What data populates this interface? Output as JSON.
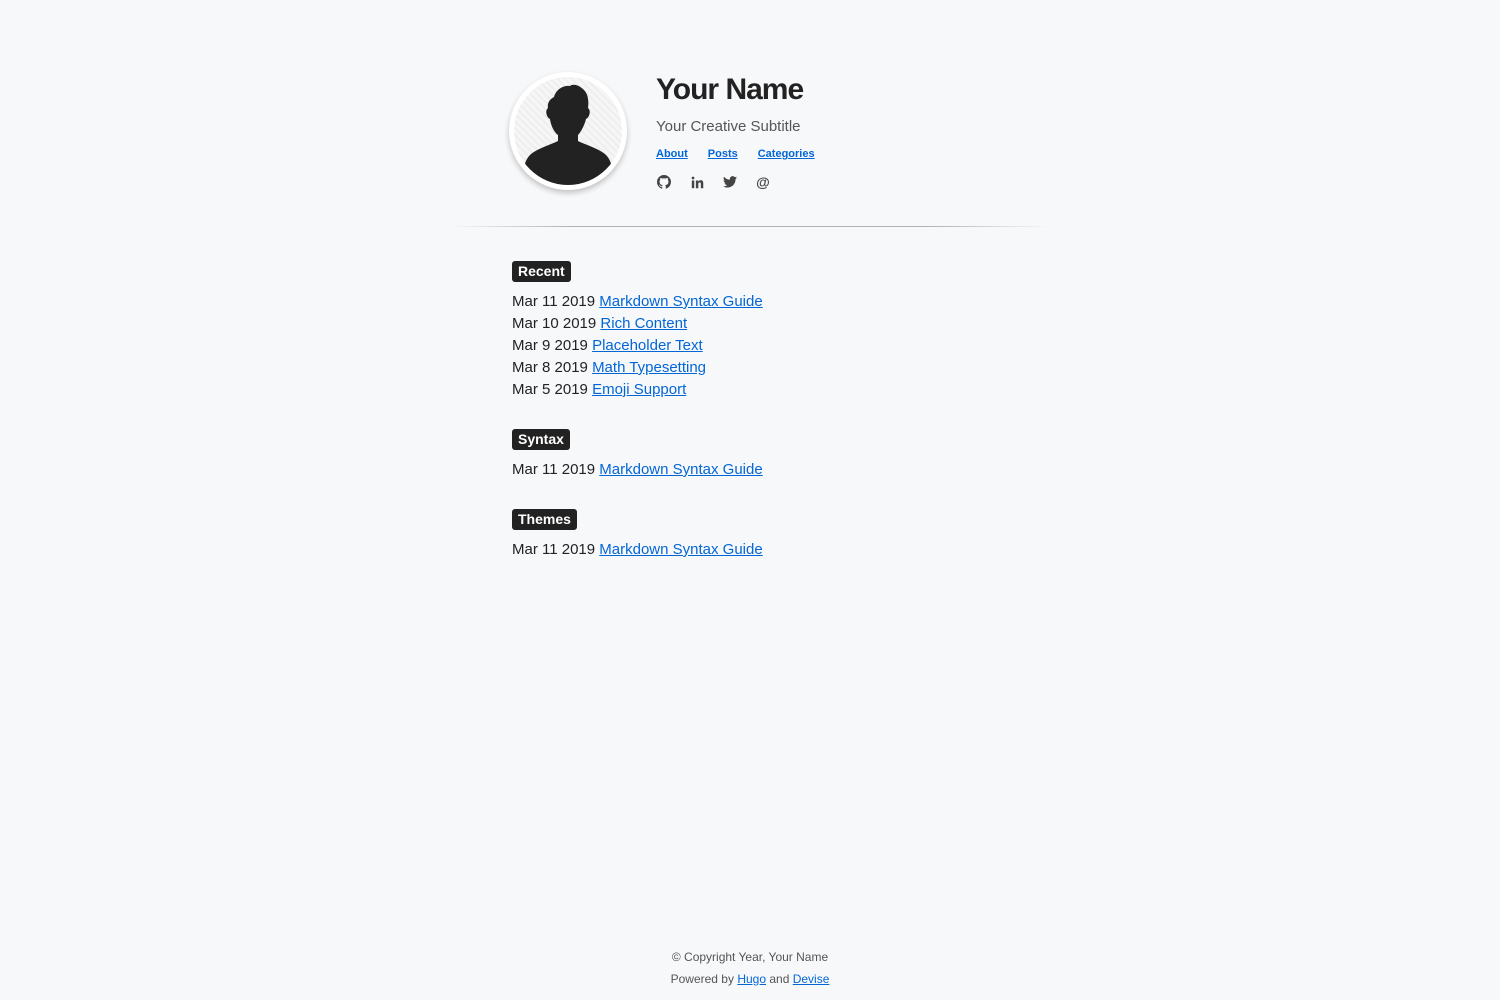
{
  "header": {
    "title": "Your Name",
    "subtitle": "Your Creative Subtitle",
    "nav": [
      {
        "label": "About"
      },
      {
        "label": "Posts"
      },
      {
        "label": "Categories"
      }
    ],
    "social": [
      {
        "icon": "github-icon"
      },
      {
        "icon": "linkedin-icon"
      },
      {
        "icon": "twitter-icon"
      },
      {
        "icon": "email-at-icon",
        "glyph": "@"
      }
    ]
  },
  "sections": [
    {
      "label": "Recent",
      "posts": [
        {
          "date": "Mar 11 2019",
          "title": "Markdown Syntax Guide"
        },
        {
          "date": "Mar 10 2019",
          "title": "Rich Content"
        },
        {
          "date": "Mar 9 2019",
          "title": "Placeholder Text"
        },
        {
          "date": "Mar 8 2019",
          "title": "Math Typesetting"
        },
        {
          "date": "Mar 5 2019",
          "title": "Emoji Support"
        }
      ]
    },
    {
      "label": "Syntax",
      "posts": [
        {
          "date": "Mar 11 2019",
          "title": "Markdown Syntax Guide"
        }
      ]
    },
    {
      "label": "Themes",
      "posts": [
        {
          "date": "Mar 11 2019",
          "title": "Markdown Syntax Guide"
        }
      ]
    }
  ],
  "footer": {
    "copyright": "© Copyright Year, Your Name",
    "powered_prefix": "Powered by",
    "hugo": "Hugo",
    "and": "and",
    "devise": "Devise"
  },
  "colors": {
    "background": "#f7f8fa",
    "link": "#0366d6",
    "badge": "#222222"
  }
}
